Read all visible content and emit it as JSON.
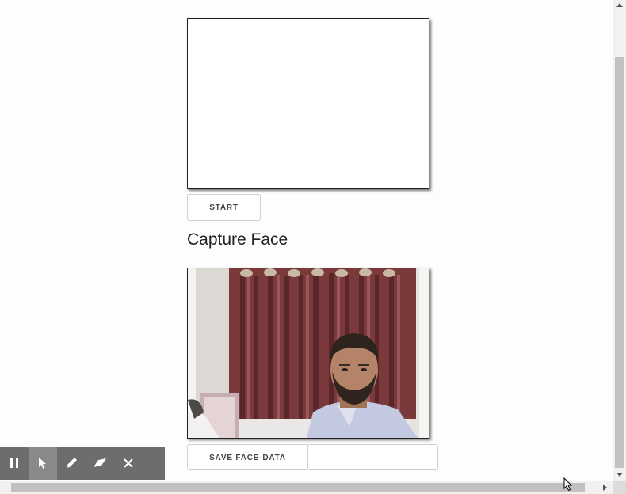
{
  "capture": {
    "start_label": "START",
    "heading": "Capture Face",
    "save_label": "SAVE FACE-DATA",
    "name_value": ""
  },
  "toolbar": {
    "tools": [
      "pause-icon",
      "pointer-icon",
      "pen-icon",
      "eraser-icon",
      "close-icon"
    ],
    "active": "pointer-icon"
  },
  "colors": {
    "toolbar_bg": "#6d6d6d",
    "toolbar_active": "#8a8a8a",
    "curtain": "#7a3a3c"
  }
}
